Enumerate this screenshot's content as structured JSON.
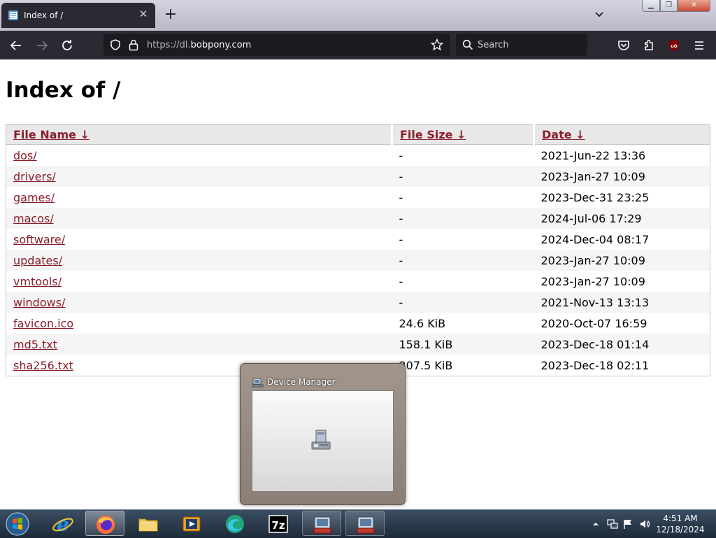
{
  "browser": {
    "tab_title": "Index of /",
    "tab_close": "✕",
    "new_tab": "+",
    "url_prefix": "https://dl.",
    "url_domain": "bobpony.com",
    "search_placeholder": "Search"
  },
  "page": {
    "title": "Index of /",
    "columns": [
      "File Name  ↓",
      "File Size  ↓",
      "Date  ↓"
    ],
    "rows": [
      {
        "name": "dos/",
        "size": "-",
        "date": "2021-Jun-22 13:36"
      },
      {
        "name": "drivers/",
        "size": "-",
        "date": "2023-Jan-27 10:09"
      },
      {
        "name": "games/",
        "size": "-",
        "date": "2023-Dec-31 23:25"
      },
      {
        "name": "macos/",
        "size": "-",
        "date": "2024-Jul-06 17:29"
      },
      {
        "name": "software/",
        "size": "-",
        "date": "2024-Dec-04 08:17"
      },
      {
        "name": "updates/",
        "size": "-",
        "date": "2023-Jan-27 10:09"
      },
      {
        "name": "vmtools/",
        "size": "-",
        "date": "2023-Jan-27 10:09"
      },
      {
        "name": "windows/",
        "size": "-",
        "date": "2021-Nov-13 13:13"
      },
      {
        "name": "favicon.ico",
        "size": "24.6 KiB",
        "date": "2020-Oct-07 16:59"
      },
      {
        "name": "md5.txt",
        "size": "158.1 KiB",
        "date": "2023-Dec-18 01:14"
      },
      {
        "name": "sha256.txt",
        "size": "207.5 KiB",
        "date": "2023-Dec-18 02:11"
      }
    ]
  },
  "popup": {
    "title": "Device Manager"
  },
  "taskbar": {
    "items": [
      "start-orb-icon",
      "internet-explorer-icon",
      "firefox-icon",
      "file-explorer-icon",
      "media-player-icon",
      "edge-icon",
      "7zip-icon",
      "device-manager-icon",
      "device-manager-icon"
    ],
    "clock_time": "4:51 AM",
    "clock_date": "12/18/2024"
  },
  "colors": {
    "link": "#8b1e2b",
    "toolbar": "#2b2a33",
    "urlbar": "#1c1b22"
  }
}
